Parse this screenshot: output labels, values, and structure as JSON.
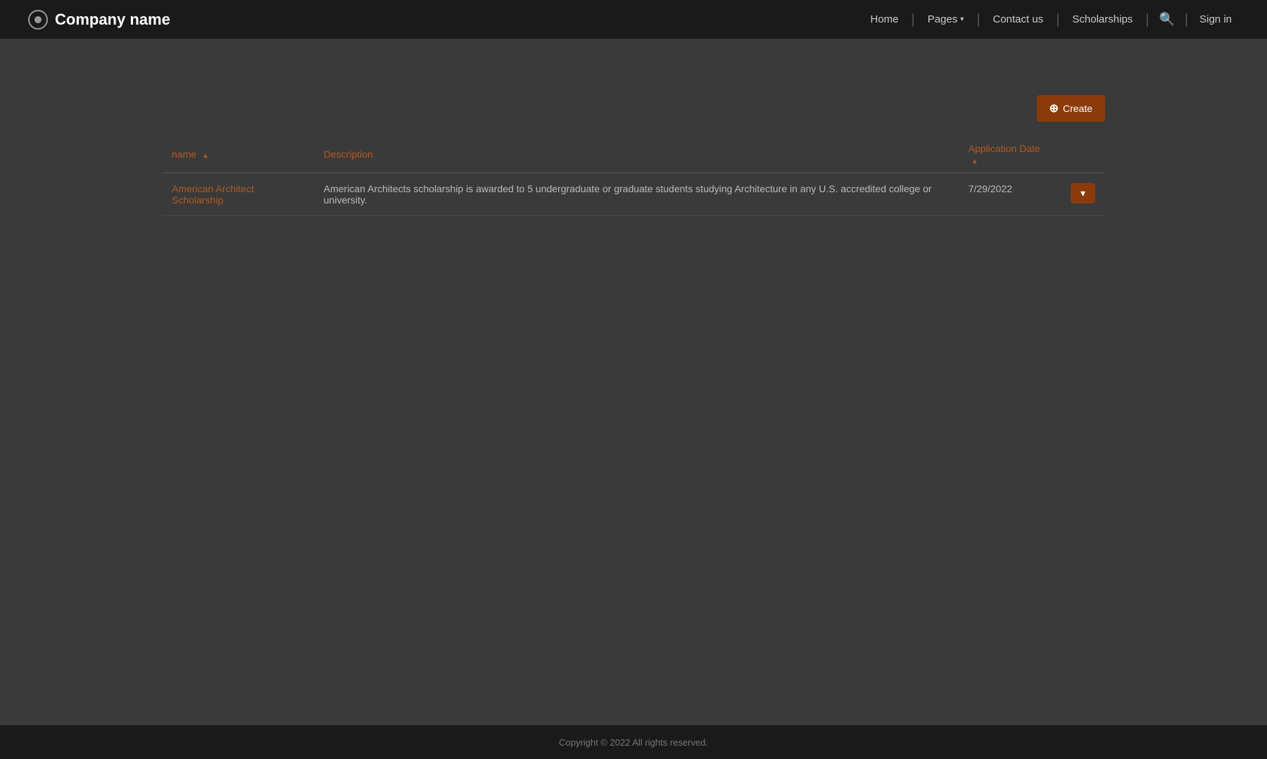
{
  "brand": {
    "name": "Company name"
  },
  "navbar": {
    "home_label": "Home",
    "pages_label": "Pages",
    "contact_label": "Contact us",
    "scholarships_label": "Scholarships",
    "signin_label": "Sign in"
  },
  "toolbar": {
    "create_label": "Create",
    "create_plus": "+"
  },
  "table": {
    "col_name": "name",
    "col_description": "Description",
    "col_date": "Application Date",
    "rows": [
      {
        "name": "American Architect Scholarship",
        "description": "American Architects scholarship is awarded to 5 undergraduate or graduate students studying Architecture in any U.S. accredited college or university.",
        "date": "7/29/2022"
      }
    ]
  },
  "footer": {
    "copyright": "Copyright © 2022  All rights reserved."
  }
}
